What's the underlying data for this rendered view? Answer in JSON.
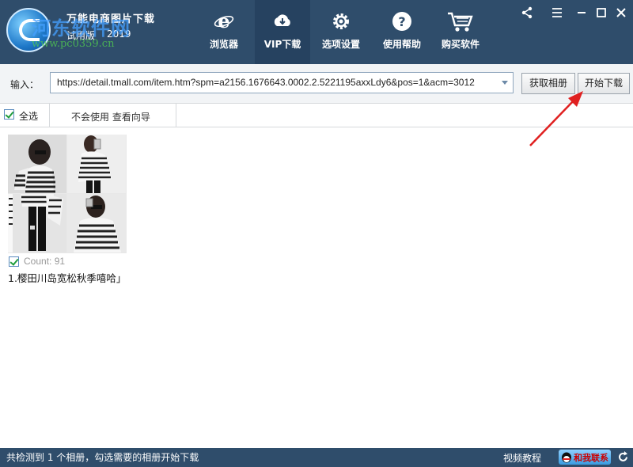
{
  "header": {
    "app_title": "万能电商图片下载",
    "edition": "试用版",
    "year": "2019",
    "watermark_main": "河东软件网",
    "watermark_url": "www.pc0359.cn",
    "nav": [
      {
        "label": "浏览器",
        "icon": "browser-e-icon"
      },
      {
        "label": "VIP下载",
        "icon": "cloud-download-icon"
      },
      {
        "label": "选项设置",
        "icon": "gear-icon"
      },
      {
        "label": "使用帮助",
        "icon": "help-icon"
      },
      {
        "label": "购买软件",
        "icon": "cart-icon"
      }
    ],
    "active_nav": "VIP下载",
    "window_controls": [
      "share-icon",
      "menu-icon",
      "minimize-icon",
      "maximize-icon",
      "close-icon"
    ]
  },
  "input_row": {
    "label": "输入：",
    "url_value": "https://detail.tmall.com/item.htm?spm=a2156.1676643.0002.2.5221195axxLdy6&pos=1&acm=3012",
    "fetch_button": "获取相册",
    "start_button": "开始下载"
  },
  "toolbar": {
    "select_all": "全选",
    "help_link": "不会使用 查看向导"
  },
  "albums": [
    {
      "count_label": "Count: 91",
      "title": "1.樱田川岛宽松秋季嘻哈」",
      "checked": true
    }
  ],
  "status": {
    "message": "共检测到 1 个相册，勾选需要的相册开始下载",
    "video_tutorial": "视频教程",
    "contact": "和我联系"
  },
  "colors": {
    "header_bg": "#2f4d6b",
    "arrow": "#e02020"
  }
}
